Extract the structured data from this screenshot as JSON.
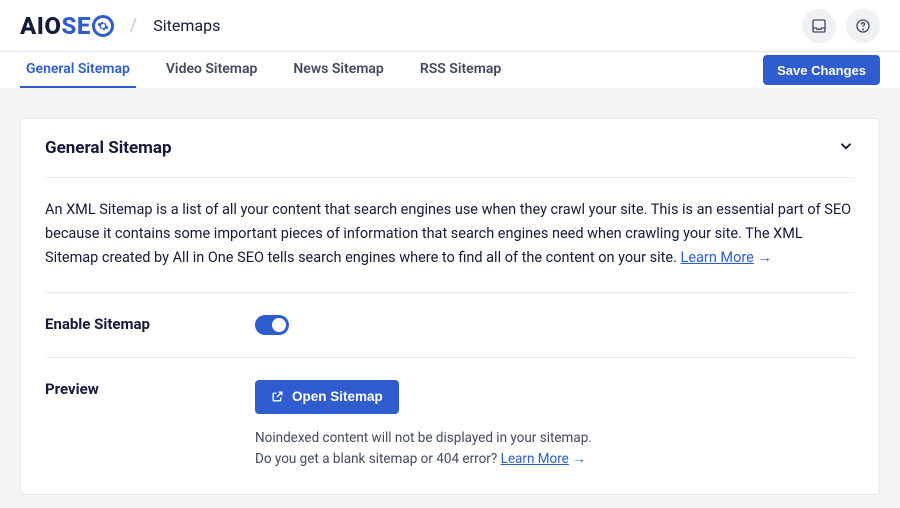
{
  "header": {
    "logo_aio": "AIO",
    "logo_se": "SE",
    "crumb_sep": "/",
    "crumb": "Sitemaps"
  },
  "tabs": {
    "t0": "General Sitemap",
    "t1": "Video Sitemap",
    "t2": "News Sitemap",
    "t3": "RSS Sitemap",
    "save": "Save Changes"
  },
  "card": {
    "title": "General Sitemap",
    "desc": "An XML Sitemap is a list of all your content that search engines use when they crawl your site. This is an essential part of SEO because it contains some important pieces of information that search engines need when crawling your site. The XML Sitemap created by All in One SEO tells search engines where to find all of the content on your site. ",
    "learn_more": "Learn More",
    "arrow": "→"
  },
  "enable": {
    "label": "Enable Sitemap"
  },
  "preview": {
    "label": "Preview",
    "button": "Open Sitemap",
    "note1": "Noindexed content will not be displayed in your sitemap.",
    "note2a": "Do you get a blank sitemap or 404 error? ",
    "note2_link": "Learn More",
    "note2_arrow": "→"
  }
}
